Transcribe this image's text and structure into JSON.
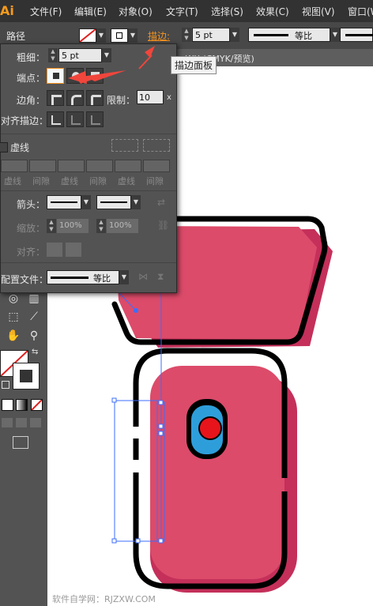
{
  "menubar": {
    "logo": "Ai",
    "items": [
      "文件(F)",
      "编辑(E)",
      "对象(O)",
      "文字(T)",
      "选择(S)",
      "效果(C)",
      "视图(V)",
      "窗口(W)"
    ]
  },
  "controlbar": {
    "path_label": "路径",
    "stroke_label": "描边",
    "stroke_weight": "5 pt",
    "profile_label": "等比"
  },
  "tooltip": "描边面板",
  "document_tab": {
    "title": "...WX (CMYK/预览)"
  },
  "stroke_panel": {
    "weight_label": "粗细：",
    "weight_value": "5 pt",
    "cap_label": "端点：",
    "corner_label": "边角：",
    "limit_label": "限制：",
    "limit_value": "10",
    "limit_unit": "x",
    "align_label": "对齐描边：",
    "dashed_label": "虚线",
    "dash_labels": [
      "虚线",
      "间隙",
      "虚线",
      "间隙",
      "虚线",
      "间隙"
    ],
    "arrow_label": "箭头：",
    "scale_label": "缩放：",
    "scale_start": "100%",
    "scale_end": "100%",
    "align_arrow_label": "对齐：",
    "profile_label": "配置文件：",
    "profile_value": "等比"
  },
  "colors": {
    "accent": "#f7931e",
    "arrow": "#f0463c",
    "shape_fill": "#dc4b6a",
    "shape_shadow": "#c4305a",
    "eye_blue": "#2e9edb",
    "eye_red": "#e8141b",
    "selection": "#3c6eff"
  },
  "watermark": "软件自学网：RJZXW.COM"
}
